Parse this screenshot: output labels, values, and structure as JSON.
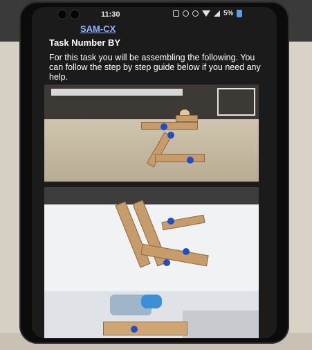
{
  "status_bar": {
    "time": "11:30",
    "battery": "5%"
  },
  "app": {
    "title": "SAM-CX"
  },
  "task": {
    "title": "Task Number BY",
    "intro": "For this task you will be assembling the following. You can follow the step by step guide below if you need any help."
  },
  "colors": {
    "link": "#8fb8ff",
    "screen_bg": "#1b1b1c",
    "text": "#ffffff",
    "knob": "#1e4fc6"
  },
  "icons": [
    "notification-icon",
    "sync-icon",
    "alarm-icon",
    "wifi-icon",
    "signal-icon",
    "battery-icon"
  ]
}
